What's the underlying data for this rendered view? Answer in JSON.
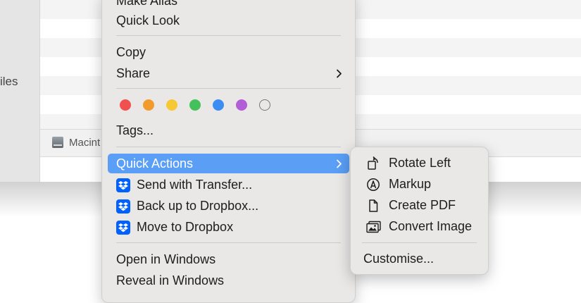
{
  "finder": {
    "sidebar_label": "iles",
    "status_disk_label": "Macint"
  },
  "menu": {
    "make_alias": "Make Alias",
    "quick_look": "Quick Look",
    "copy": "Copy",
    "share": "Share",
    "tags_label": "Tags...",
    "quick_actions": "Quick Actions",
    "send_with_transfer": "Send with Transfer...",
    "backup_to_dropbox": "Back up to Dropbox...",
    "move_to_dropbox": "Move to Dropbox",
    "open_in_windows": "Open in Windows",
    "reveal_in_windows": "Reveal in Windows"
  },
  "tag_colors": [
    "#f0504e",
    "#f39a2c",
    "#f6c834",
    "#44c15a",
    "#3b8df2",
    "#b25ed6",
    "none"
  ],
  "submenu": {
    "rotate_left": "Rotate Left",
    "markup": "Markup",
    "create_pdf": "Create PDF",
    "convert_image": "Convert Image",
    "customise": "Customise..."
  },
  "colors": {
    "highlight": "#5a9ef5",
    "menu_bg": "#e9e8e7",
    "dropbox_blue": "#0061fe"
  }
}
